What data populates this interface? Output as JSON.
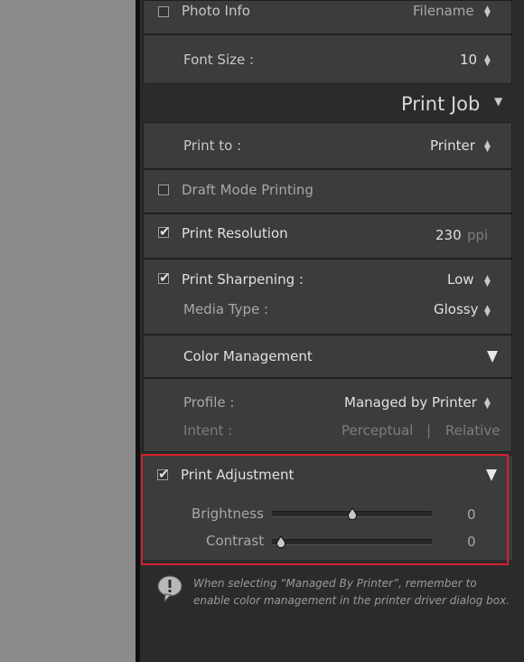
{
  "photo_info": {
    "label": "Photo Info",
    "value": "Filename"
  },
  "font_size": {
    "label": "Font Size :",
    "value": "10"
  },
  "print_job": {
    "title": "Print Job"
  },
  "print_to": {
    "label": "Print to :",
    "value": "Printer"
  },
  "draft_mode": {
    "label": "Draft Mode Printing"
  },
  "print_resolution": {
    "label": "Print Resolution",
    "value": "230",
    "unit": "ppi"
  },
  "print_sharpening": {
    "label": "Print Sharpening :",
    "value": "Low"
  },
  "media_type": {
    "label": "Media Type :",
    "value": "Glossy"
  },
  "color_management": {
    "title": "Color Management",
    "profile_label": "Profile :",
    "profile_value": "Managed by Printer",
    "intent_label": "Intent :",
    "intent_perceptual": "Perceptual",
    "intent_sep": "|",
    "intent_relative": "Relative"
  },
  "print_adjustment": {
    "label": "Print Adjustment",
    "brightness_label": "Brightness",
    "brightness_value": "0",
    "contrast_label": "Contrast",
    "contrast_value": "0"
  },
  "note": {
    "line1": "When selecting “Managed By Printer”, remember to",
    "line2": "enable color management in the printer driver dialog box."
  }
}
